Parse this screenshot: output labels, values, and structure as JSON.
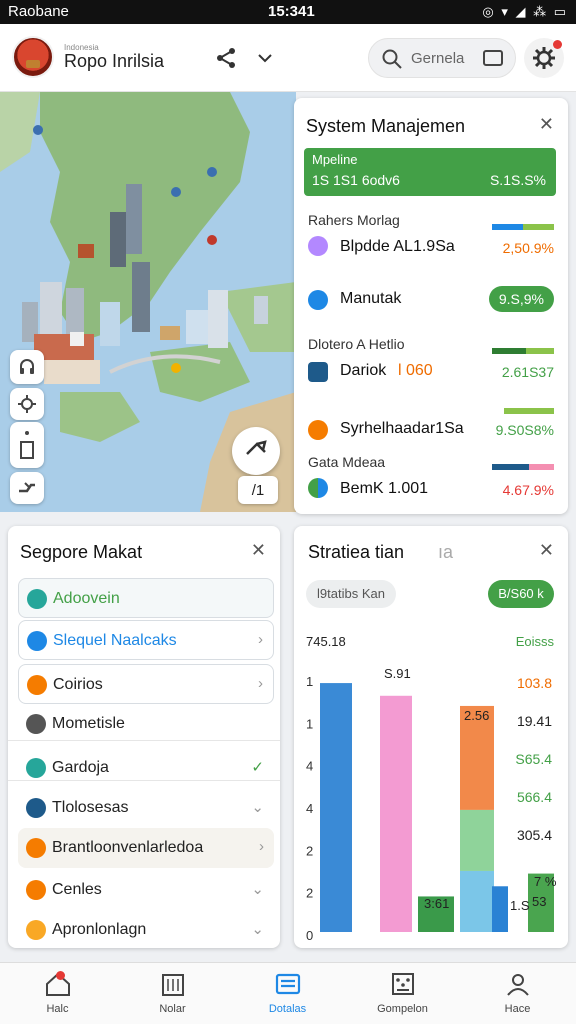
{
  "status_bar": {
    "carrier": "Raobane",
    "time": "15:341",
    "icons": "wifi-signal-battery"
  },
  "header": {
    "brand_small": "Indonesia",
    "brand": "Ropo Inrilsia",
    "search_placeholder": "Gernela"
  },
  "map": {
    "tool_label": "/1"
  },
  "system_panel": {
    "title": "System Manajemen",
    "banner": {
      "line1": "Mpeline",
      "line2": "1S 1S1 6odv6",
      "value": "S.1S.S%"
    },
    "rows": [
      {
        "caption": "Rahers Morlag",
        "name": "Blpdde AL1.9Sa",
        "value": "2,50.9%",
        "value_color": "#ef6c00",
        "icon": "purple-leaf-icon"
      },
      {
        "caption": "",
        "name": "Manutak",
        "value": "9.S,9%",
        "value_color": "#ffffff",
        "icon": "globe-icon",
        "pill": true
      },
      {
        "caption": "Dlotero A Hetlio",
        "name": "Dariok",
        "name_accent": "l 060",
        "value": "2.61S37",
        "value_color": "#43a047",
        "icon": "grid-globe-icon"
      },
      {
        "caption": "",
        "name": "Syrhelhaadar1Sa",
        "value": "9.S0S8%",
        "value_color": "#43a047",
        "icon": "sun-icon"
      },
      {
        "caption": "Gata Mdeaa",
        "name": "BemK 1.001",
        "name_accent": "",
        "value": "4.67.9%",
        "value_color": "#e53935",
        "icon": "flag-icon"
      }
    ]
  },
  "market_panel": {
    "title": "Segpore Makat",
    "items": [
      {
        "label": "Adoovein",
        "color": "#43a047",
        "icon": "cloud-icon",
        "icon_color": "#26a69a",
        "trailing": "",
        "boxed": true,
        "highlight": "#f4f8f9"
      },
      {
        "label": "Slequel Naalcaks",
        "color": "#1e88e5",
        "icon": "cloud-icon",
        "icon_color": "#1e88e5",
        "trailing": "›",
        "boxed": true,
        "highlight": ""
      },
      {
        "label": "Coirios",
        "color": "#222222",
        "icon": "coin-icon",
        "icon_color": "#f57c00",
        "trailing": "›",
        "boxed": true,
        "highlight": ""
      },
      {
        "label": "Mometisle",
        "color": "#222222",
        "icon": "tools-icon",
        "icon_color": "#555555",
        "trailing": "",
        "boxed": false,
        "highlight": ""
      },
      {
        "label": "Gardoja",
        "color": "#222222",
        "icon": "leaf-icon",
        "icon_color": "#26a69a",
        "trailing": "✓",
        "boxed": false,
        "highlight": ""
      },
      {
        "label": "Tlolosesas",
        "color": "#222222",
        "icon": "building-icon",
        "icon_color": "#1e5a8a",
        "trailing": "⌄",
        "boxed": false,
        "highlight": ""
      },
      {
        "label": "Brantloonvenlarledoa",
        "color": "#222222",
        "icon": "box-icon",
        "icon_color": "#f57c00",
        "trailing": "›",
        "boxed": false,
        "highlight": "#f5f3ee"
      },
      {
        "label": "Cenles",
        "color": "#222222",
        "icon": "coin-icon",
        "icon_color": "#f57c00",
        "trailing": "⌄",
        "boxed": false,
        "highlight": ""
      },
      {
        "label": "Apronlonlagn",
        "color": "#222222",
        "icon": "lock-icon",
        "icon_color": "#f9a825",
        "trailing": "⌄",
        "boxed": false,
        "highlight": ""
      }
    ]
  },
  "stats_panel": {
    "title": "Stratiea tian",
    "title_suffix": "ıa",
    "chip": "l9tatibs Kan",
    "chip_right": "B/S60 k",
    "label_tl": "745.18",
    "label_tr": "Eoisss"
  },
  "chart_data": {
    "type": "bar",
    "yticks": [
      "1",
      "1",
      "4",
      "4",
      "2",
      "2",
      "0"
    ],
    "right_labels": [
      {
        "text": "103.8",
        "color": "#ef6c00"
      },
      {
        "text": "19.41",
        "color": "#222222"
      },
      {
        "text": "S65.4",
        "color": "#43a047"
      },
      {
        "text": "566.4",
        "color": "#43a047"
      },
      {
        "text": "305.4",
        "color": "#222222"
      }
    ],
    "bar_labels": [
      "S.91",
      "2.56",
      "3:61",
      "1.S",
      "53",
      "7 %"
    ],
    "bars": [
      {
        "name": "",
        "value": 0.98,
        "color": "#3a8ad6"
      },
      {
        "name": "",
        "value": 0.93,
        "color": "#f39bd2"
      },
      {
        "name": "",
        "value": 0.14,
        "color": "#3a9a4a"
      },
      {
        "name": "",
        "value": 0.89,
        "color": "#f2894a",
        "segments": [
          {
            "frac": 0.46,
            "color": "#f2894a"
          },
          {
            "frac": 0.27,
            "color": "#8fd39a"
          },
          {
            "frac": 0.27,
            "color": "#7bc6e8"
          }
        ]
      },
      {
        "name": "",
        "value": 0.18,
        "color": "#2a82d4"
      },
      {
        "name": "",
        "value": 0.23,
        "color": "#4aa54f"
      }
    ]
  },
  "nav": {
    "items": [
      {
        "label": "Halc",
        "icon": "home-icon",
        "active": false,
        "badge": true
      },
      {
        "label": "Nolar",
        "icon": "calendar-icon",
        "active": false,
        "badge": false
      },
      {
        "label": "Dotalas",
        "icon": "list-icon",
        "active": true,
        "badge": false
      },
      {
        "label": "Gompelon",
        "icon": "dice-icon",
        "active": false,
        "badge": false
      },
      {
        "label": "Hace",
        "icon": "profile-icon",
        "active": false,
        "badge": false
      }
    ]
  }
}
